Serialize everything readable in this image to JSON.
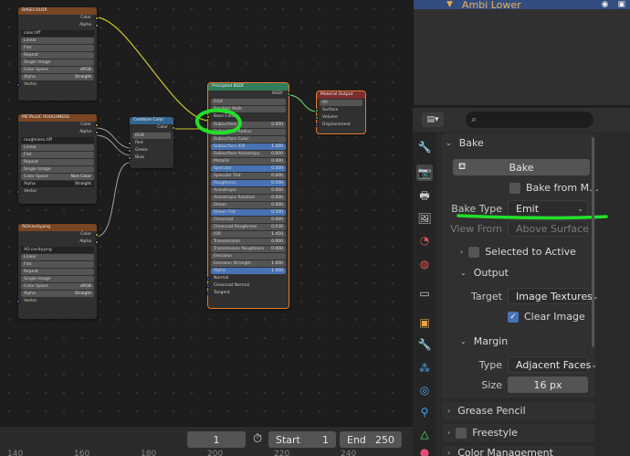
{
  "outliner": {
    "row_label": "Ambi Lower"
  },
  "nodes": {
    "tex1": {
      "title": "BASECOLOR",
      "out_color": "Color",
      "out_alpha": "Alpha",
      "image_name": "color.tiff",
      "interp": "Linear",
      "proj": "Flat",
      "ext": "Repeat",
      "source": "Single Image",
      "cs_label": "Color Space",
      "cs_value": "sRGB",
      "alpha_label": "Alpha",
      "alpha_value": "Straight",
      "in_vector": "Vector"
    },
    "tex2": {
      "title": "METALLIC ROUGHNESS",
      "out_color": "Color",
      "out_alpha": "Alpha",
      "image_name": "roughness.tiff",
      "interp": "Linear",
      "proj": "Flat",
      "ext": "Repeat",
      "source": "Single Image",
      "cs_label": "Color Space",
      "cs_value": "Non-Color",
      "alpha_label": "Alpha",
      "alpha_value": "Straight",
      "in_vector": "Vector"
    },
    "tex3": {
      "title": "AO/cavity.png",
      "out_color": "Color",
      "out_alpha": "Alpha",
      "image_name": "AO.cavity.png",
      "interp": "Linear",
      "proj": "Flat",
      "ext": "Repeat",
      "source": "Single Image",
      "cs_label": "Color Space",
      "cs_value": "sRGB",
      "alpha_label": "Alpha",
      "alpha_value": "Straight",
      "in_vector": "Vector"
    },
    "combine": {
      "title": "Combine Color",
      "out_color": "Color",
      "mode": "RGB",
      "in_red": "Red",
      "in_green": "Green",
      "in_blue": "Blue"
    },
    "bsdf": {
      "title": "Principled BSDF",
      "out_bsdf": "BSDF",
      "distribution": "GGX",
      "subsurface_method": "Random Walk",
      "base_color": "Base Color",
      "rows": [
        {
          "label": "Subsurface",
          "value": "0.000"
        },
        {
          "label": "Subsurface Radius",
          "value": ""
        },
        {
          "label": "Subsurface Color",
          "value": ""
        },
        {
          "label": "Subsurface IOR",
          "value": "1.400"
        },
        {
          "label": "Subsurface Anisotropy",
          "value": "0.000"
        },
        {
          "label": "Metallic",
          "value": "0.000"
        },
        {
          "label": "Specular",
          "value": "0.500"
        },
        {
          "label": "Specular Tint",
          "value": "0.000"
        },
        {
          "label": "Roughness",
          "value": "0.500"
        },
        {
          "label": "Anisotropic",
          "value": "0.000"
        },
        {
          "label": "Anisotropic Rotation",
          "value": "0.000"
        },
        {
          "label": "Sheen",
          "value": "0.000"
        },
        {
          "label": "Sheen Tint",
          "value": "0.500"
        },
        {
          "label": "Clearcoat",
          "value": "0.000"
        },
        {
          "label": "Clearcoat Roughness",
          "value": "0.030"
        },
        {
          "label": "IOR",
          "value": "1.450"
        },
        {
          "label": "Transmission",
          "value": "0.000"
        },
        {
          "label": "Transmission Roughness",
          "value": "0.000"
        },
        {
          "label": "Emission",
          "value": ""
        },
        {
          "label": "Emission Strength",
          "value": "1.000"
        },
        {
          "label": "Alpha",
          "value": "1.000"
        }
      ],
      "normal": "Normal",
      "clearcoat_normal": "Clearcoat Normal",
      "tangent": "Tangent"
    },
    "output": {
      "title": "Material Output",
      "target": "All",
      "in_surface": "Surface",
      "in_volume": "Volume",
      "in_displacement": "Displacement"
    }
  },
  "properties": {
    "bake_panel_title": "Bake",
    "bake_button": "Bake",
    "bake_from_multires": "Bake from M...",
    "bake_type_label": "Bake Type",
    "bake_type_value": "Emit",
    "view_from_label": "View From",
    "view_from_value": "Above Surface",
    "selected_to_active": "Selected to Active",
    "output_title": "Output",
    "target_label": "Target",
    "target_value": "Image Textures",
    "clear_image": "Clear Image",
    "margin_title": "Margin",
    "margin_type_label": "Type",
    "margin_type_value": "Adjacent Faces",
    "size_label": "Size",
    "size_value": "16 px",
    "grease_pencil": "Grease Pencil",
    "freestyle": "Freestyle",
    "color_management": "Color Management"
  },
  "timeline": {
    "current_frame": "1",
    "start_label": "Start",
    "start_value": "1",
    "end_label": "End",
    "end_value": "250",
    "ruler": [
      "140",
      "160",
      "180",
      "200",
      "220",
      "240"
    ]
  }
}
